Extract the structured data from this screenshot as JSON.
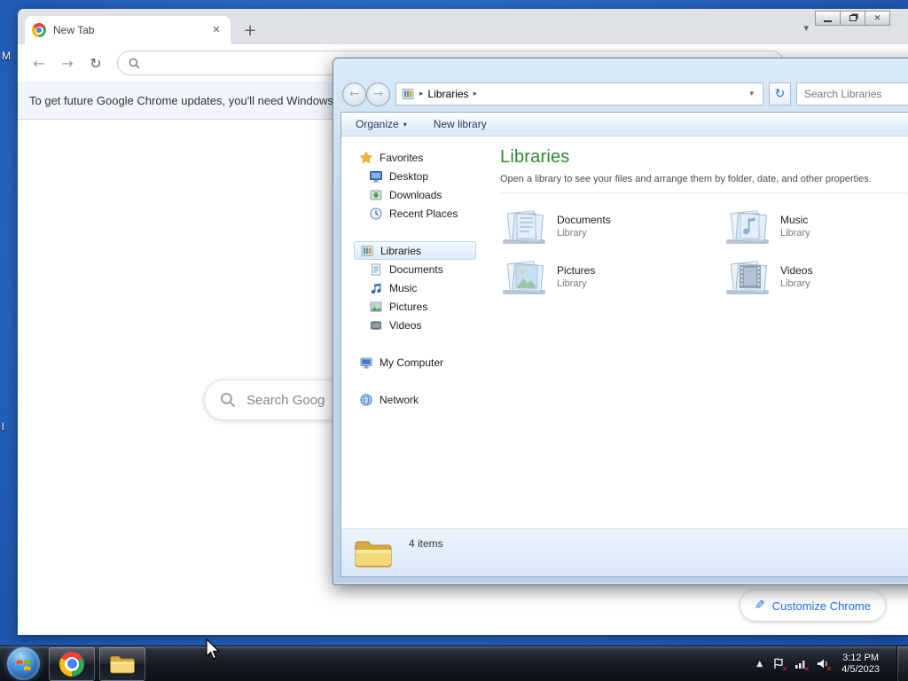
{
  "chrome": {
    "tab_title": "New Tab",
    "infobar_text": "To get future Google Chrome updates, you'll need Windows",
    "search_placeholder": "Search Goog",
    "customize_button": "Customize Chrome"
  },
  "explorer": {
    "address_location": "Libraries",
    "search_placeholder": "Search Libraries",
    "command_bar": {
      "organize": "Organize",
      "new_library": "New library"
    },
    "nav": {
      "favorites_label": "Favorites",
      "favorites": [
        "Desktop",
        "Downloads",
        "Recent Places"
      ],
      "libraries_label": "Libraries",
      "libraries": [
        "Documents",
        "Music",
        "Pictures",
        "Videos"
      ],
      "computer_label": "My Computer",
      "network_label": "Network"
    },
    "main": {
      "title": "Libraries",
      "description": "Open a library to see your files and arrange them by folder, date, and other properties.",
      "tiles": [
        {
          "name": "Documents",
          "type": "Library"
        },
        {
          "name": "Music",
          "type": "Library"
        },
        {
          "name": "Pictures",
          "type": "Library"
        },
        {
          "name": "Videos",
          "type": "Library"
        }
      ]
    },
    "status": "4 items"
  },
  "taskbar": {
    "time": "3:12 PM",
    "date": "4/5/2023"
  },
  "desktop": {
    "icon_fragments": [
      "M",
      "l"
    ]
  },
  "icons": {
    "back": "←",
    "forward": "→",
    "reload": "↻",
    "plus": "+",
    "close": "✕",
    "chevron_down": "▾",
    "breadcrumb_arrow": "▸",
    "tray_up": "▲",
    "pencil": "✎"
  },
  "colors": {
    "accent_blue": "#1a73e8",
    "libraries_green": "#2c8a2c",
    "desktop_blue": "#2563bb"
  }
}
